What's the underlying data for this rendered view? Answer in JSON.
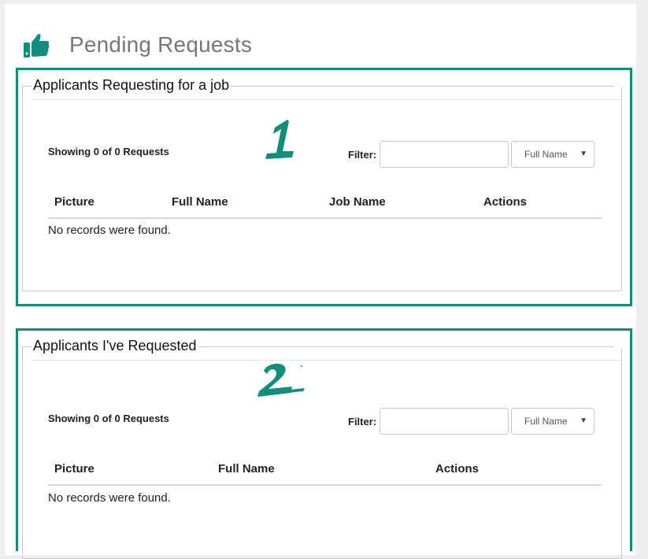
{
  "page": {
    "title": "Pending Requests",
    "icon": "thumbs-up-icon"
  },
  "colors": {
    "accent": "#138d7b",
    "title_gray": "#777777"
  },
  "panel_job": {
    "legend": "Applicants Requesting for a job",
    "number": "1",
    "showing": "Showing 0 of 0 Requests",
    "filter_label": "Filter:",
    "filter_value": "",
    "select_value": "Full Name",
    "columns": [
      "Picture",
      "Full Name",
      "Job Name",
      "Actions"
    ],
    "empty_text": "No records were found."
  },
  "panel_requested": {
    "legend": "Applicants I've Requested",
    "number": "2",
    "showing": "Showing 0 of 0 Requests",
    "filter_label": "Filter:",
    "filter_value": "",
    "select_value": "Full Name",
    "columns": [
      "Picture",
      "Full Name",
      "Actions"
    ],
    "empty_text": "No records were found."
  }
}
